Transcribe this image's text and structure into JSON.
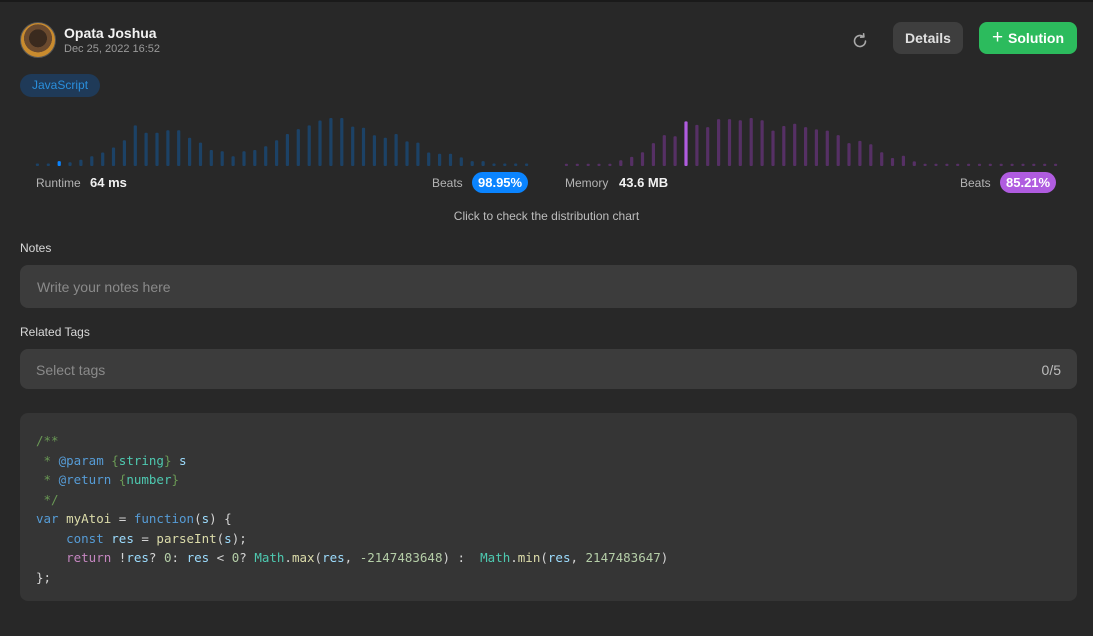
{
  "user": {
    "name": "Opata Joshua",
    "date": "Dec 25, 2022 16:52"
  },
  "toolbar": {
    "refresh_icon": "refresh-icon",
    "details_label": "Details",
    "solution_icon": "plus-icon",
    "solution_label": "Solution"
  },
  "language": "JavaScript",
  "runtime": {
    "label": "Runtime",
    "value": "64 ms",
    "beats_label": "Beats",
    "beats": "98.95%",
    "color": "#0a84ff",
    "bar_color": "#1c4266",
    "histogram": [
      2,
      2,
      4,
      3,
      5,
      8,
      11,
      15,
      21,
      33,
      27,
      27,
      29,
      29,
      23,
      19,
      13,
      12,
      8,
      12,
      13,
      16,
      21,
      26,
      30,
      33,
      37,
      39,
      39,
      32,
      31,
      25,
      23,
      26,
      20,
      19,
      11,
      10,
      10,
      7,
      4,
      4,
      2,
      2,
      2,
      2
    ],
    "highlight_index": 2
  },
  "memory": {
    "label": "Memory",
    "value": "43.6 MB",
    "beats_label": "Beats",
    "beats": "85.21%",
    "color": "#b05ce0",
    "bar_color": "#563065",
    "histogram": [
      2,
      2,
      2,
      2,
      2,
      5,
      8,
      12,
      20,
      27,
      26,
      39,
      36,
      34,
      41,
      41,
      40,
      42,
      40,
      31,
      35,
      37,
      34,
      32,
      31,
      27,
      20,
      22,
      19,
      12,
      7,
      9,
      4,
      2,
      2,
      2,
      2,
      2,
      2,
      2,
      2,
      2,
      2,
      2,
      2,
      2
    ],
    "highlight_index": 11
  },
  "distribution_hint": "Click to check the distribution chart",
  "notes": {
    "label": "Notes",
    "placeholder": "Write your notes here"
  },
  "tags": {
    "label": "Related Tags",
    "placeholder": "Select tags",
    "count": "0/5"
  },
  "code": {
    "language": "javascript",
    "lines": [
      [
        {
          "t": "/**",
          "c": "cmt"
        }
      ],
      [
        {
          "t": " * ",
          "c": "cmt"
        },
        {
          "t": "@param",
          "c": "tag"
        },
        {
          "t": " {",
          "c": "cmt"
        },
        {
          "t": "string",
          "c": "type"
        },
        {
          "t": "} ",
          "c": "cmt"
        },
        {
          "t": "s",
          "c": "var"
        }
      ],
      [
        {
          "t": " * ",
          "c": "cmt"
        },
        {
          "t": "@return",
          "c": "tag"
        },
        {
          "t": " {",
          "c": "cmt"
        },
        {
          "t": "number",
          "c": "type"
        },
        {
          "t": "}",
          "c": "cmt"
        }
      ],
      [
        {
          "t": " */",
          "c": "cmt"
        }
      ],
      [
        {
          "t": "var ",
          "c": "kw"
        },
        {
          "t": "myAtoi",
          "c": "fn"
        },
        {
          "t": " = ",
          "c": "op"
        },
        {
          "t": "function",
          "c": "kw"
        },
        {
          "t": "(",
          "c": "op"
        },
        {
          "t": "s",
          "c": "var"
        },
        {
          "t": ") {",
          "c": "op"
        }
      ],
      [
        {
          "t": "    ",
          "c": "op"
        },
        {
          "t": "const ",
          "c": "kw"
        },
        {
          "t": "res",
          "c": "var"
        },
        {
          "t": " = ",
          "c": "op"
        },
        {
          "t": "parseInt",
          "c": "fn"
        },
        {
          "t": "(",
          "c": "op"
        },
        {
          "t": "s",
          "c": "var"
        },
        {
          "t": ");",
          "c": "op"
        }
      ],
      [
        {
          "t": "    ",
          "c": "op"
        },
        {
          "t": "return ",
          "c": "ctrl"
        },
        {
          "t": "!",
          "c": "op"
        },
        {
          "t": "res",
          "c": "var"
        },
        {
          "t": "? ",
          "c": "op"
        },
        {
          "t": "0",
          "c": "num"
        },
        {
          "t": ": ",
          "c": "op"
        },
        {
          "t": "res",
          "c": "var"
        },
        {
          "t": " < ",
          "c": "op"
        },
        {
          "t": "0",
          "c": "num"
        },
        {
          "t": "? ",
          "c": "op"
        },
        {
          "t": "Math",
          "c": "cls"
        },
        {
          "t": ".",
          "c": "op"
        },
        {
          "t": "max",
          "c": "fn"
        },
        {
          "t": "(",
          "c": "op"
        },
        {
          "t": "res",
          "c": "var"
        },
        {
          "t": ", ",
          "c": "op"
        },
        {
          "t": "-2147483648",
          "c": "num"
        },
        {
          "t": ") :  ",
          "c": "op"
        },
        {
          "t": "Math",
          "c": "cls"
        },
        {
          "t": ".",
          "c": "op"
        },
        {
          "t": "min",
          "c": "fn"
        },
        {
          "t": "(",
          "c": "op"
        },
        {
          "t": "res",
          "c": "var"
        },
        {
          "t": ", ",
          "c": "op"
        },
        {
          "t": "2147483647",
          "c": "num"
        },
        {
          "t": ")",
          "c": "op"
        }
      ],
      [
        {
          "t": "};",
          "c": "op"
        }
      ]
    ]
  }
}
